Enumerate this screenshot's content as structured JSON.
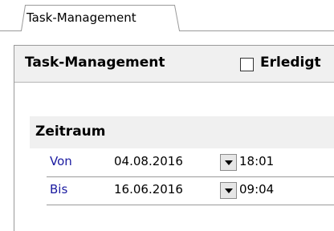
{
  "tab": {
    "label": "Task-Management"
  },
  "panel": {
    "title": "Task-Management",
    "done_label": "Erledigt",
    "done_checked": false
  },
  "zeitraum": {
    "title": "Zeitraum",
    "rows": [
      {
        "label": "Von",
        "date": "04.08.2016",
        "time": "18:01",
        "dropdown_icon": "chevron-down-icon"
      },
      {
        "label": "Bis",
        "date": "16.06.2016",
        "time": "09:04",
        "dropdown_icon": "chevron-down-icon"
      }
    ]
  }
}
